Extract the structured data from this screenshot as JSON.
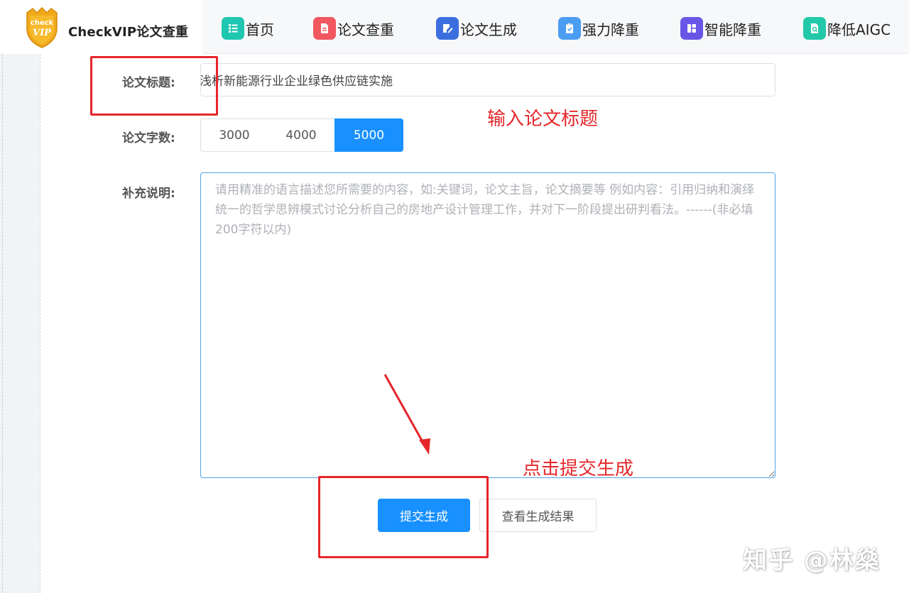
{
  "app": {
    "brand_name": "CheckVIP论文查重",
    "logo_text_top": "check",
    "logo_text_bottom": "VIP"
  },
  "nav": [
    {
      "label": "首页",
      "icon": "list-icon",
      "color": "#1fc7b1"
    },
    {
      "label": "论文查重",
      "icon": "document-icon",
      "color": "#f0575f"
    },
    {
      "label": "论文生成",
      "icon": "edit-document-icon",
      "color": "#3b6fe0"
    },
    {
      "label": "强力降重",
      "icon": "clipboard-icon",
      "color": "#4b9df2"
    },
    {
      "label": "智能降重",
      "icon": "layout-icon",
      "color": "#6a55e6"
    },
    {
      "label": "降低AIGC",
      "icon": "search-document-icon",
      "color": "#22c9a9"
    }
  ],
  "form": {
    "title_label": "论文标题:",
    "title_value": "浅析新能源行业企业绿色供应链实施",
    "wordcount_label": "论文字数:",
    "wordcount_options": [
      "3000",
      "4000",
      "5000"
    ],
    "wordcount_selected": "5000",
    "notes_label": "补充说明:",
    "notes_placeholder": "请用精准的语言描述您所需要的内容，如:关键词，论文主旨，论文摘要等 例如内容：引用归纳和演绎统一的哲学思辨模式讨论分析自己的房地产设计管理工作，并对下一阶段提出研判看法。------(非必填 200字符以内)",
    "submit_label": "提交生成",
    "view_results_label": "查看生成结果"
  },
  "annotations": {
    "title_hint": "输入论文标题",
    "submit_hint": "点击提交生成",
    "color": "#e5262b"
  },
  "watermark": "知乎 @林燊",
  "colors": {
    "primary": "#1890ff",
    "header_bg": "#f7f8fa"
  }
}
